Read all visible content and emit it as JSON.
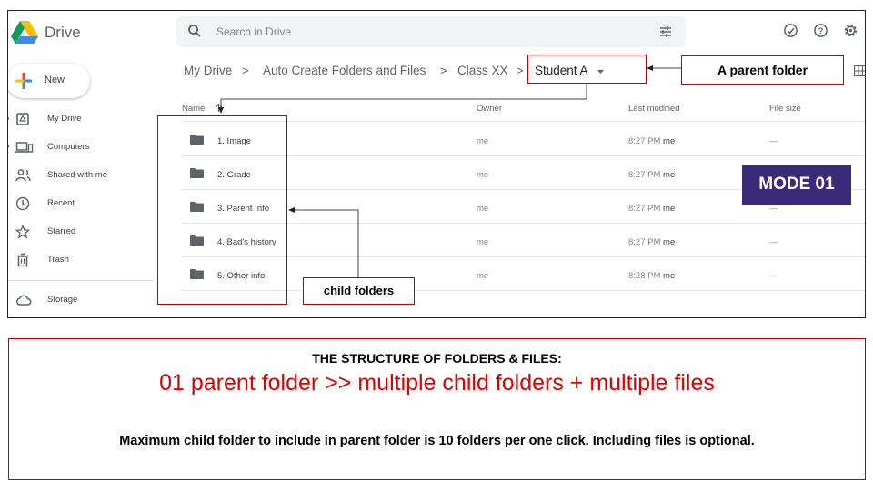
{
  "app": {
    "name": "Drive"
  },
  "search": {
    "placeholder": "Search in Drive"
  },
  "sidebar": {
    "new_label": "New",
    "items": [
      {
        "label": "My Drive"
      },
      {
        "label": "Computers"
      },
      {
        "label": "Shared with me"
      },
      {
        "label": "Recent"
      },
      {
        "label": "Starred"
      },
      {
        "label": "Trash"
      },
      {
        "label": "Storage"
      }
    ]
  },
  "breadcrumb": {
    "items": [
      "My Drive",
      "Auto Create Folders and Files",
      "Class XX"
    ],
    "separator": ">",
    "current": "Student A"
  },
  "table": {
    "columns": {
      "name": "Name",
      "owner": "Owner",
      "modified": "Last modified",
      "size": "File size"
    },
    "rows": [
      {
        "name": "1. Image",
        "owner": "me",
        "time": "8:27 PM",
        "by": "me",
        "size": "—"
      },
      {
        "name": "2. Grade",
        "owner": "me",
        "time": "8:27 PM",
        "by": "me",
        "size": ""
      },
      {
        "name": "3. Parent Info",
        "owner": "me",
        "time": "8:27 PM",
        "by": "me",
        "size": "—"
      },
      {
        "name": "4. Bad's history",
        "owner": "me",
        "time": "8:27 PM",
        "by": "me",
        "size": "—"
      },
      {
        "name": "5. Other info",
        "owner": "me",
        "time": "8:28 PM",
        "by": "me",
        "size": "—"
      }
    ]
  },
  "annotations": {
    "parent_label": "A parent folder",
    "child_label": "child folders",
    "mode": "MODE 01"
  },
  "info": {
    "heading": "THE STRUCTURE OF FOLDERS & FILES:",
    "main": "01 parent folder >> multiple child folders + multiple files",
    "note": "Maximum child folder to include in parent folder is 10 folders per one click. Including files is optional."
  },
  "colors": {
    "annotation": "#c00000",
    "mode_badge": "#3a2a7a",
    "main_text": "#e00000"
  }
}
